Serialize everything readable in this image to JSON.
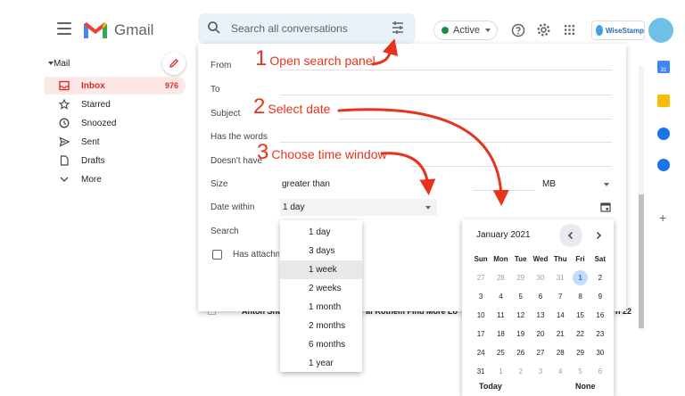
{
  "header": {
    "app_name": "Gmail",
    "search_placeholder": "Search all conversations",
    "status_label": "Active",
    "wisestamp_label": "WiseStamp"
  },
  "sidebar": {
    "section_label": "Mail",
    "items": [
      {
        "label": "Inbox",
        "count": "976",
        "icon": "inbox-icon"
      },
      {
        "label": "Starred",
        "icon": "star-icon"
      },
      {
        "label": "Snoozed",
        "icon": "clock-icon"
      },
      {
        "label": "Sent",
        "icon": "send-icon"
      },
      {
        "label": "Drafts",
        "icon": "draft-icon"
      },
      {
        "label": "More",
        "icon": "chevron-down-icon"
      }
    ]
  },
  "search_panel": {
    "from_label": "From",
    "to_label": "To",
    "subject_label": "Subject",
    "has_words_label": "Has the words",
    "doesnt_have_label": "Doesn't have",
    "size_label": "Size",
    "size_operator": "greater than",
    "size_unit": "MB",
    "date_within_label": "Date within",
    "date_within_value": "1 day",
    "search_label": "Search",
    "has_attachment_label": "Has attachment"
  },
  "date_dropdown": {
    "options": [
      "1 day",
      "3 days",
      "1 week",
      "2 weeks",
      "1 month",
      "2 months",
      "6 months",
      "1 year"
    ],
    "highlighted": "1 week"
  },
  "calendar": {
    "month_label": "January 2021",
    "weekdays": [
      "Sun",
      "Mon",
      "Tue",
      "Wed",
      "Thu",
      "Fri",
      "Sat"
    ],
    "weeks": [
      [
        "27",
        "28",
        "29",
        "30",
        "31",
        "1",
        "2"
      ],
      [
        "3",
        "4",
        "5",
        "6",
        "7",
        "8",
        "9"
      ],
      [
        "10",
        "11",
        "12",
        "13",
        "14",
        "15",
        "16"
      ],
      [
        "17",
        "18",
        "19",
        "20",
        "21",
        "22",
        "23"
      ],
      [
        "24",
        "25",
        "26",
        "27",
        "28",
        "29",
        "30"
      ],
      [
        "31",
        "1",
        "2",
        "3",
        "4",
        "5",
        "6"
      ]
    ],
    "selected_day": "1",
    "today_label": "Today",
    "none_label": "None"
  },
  "email_row": {
    "sender": "Anton Shu",
    "subject": "af Rothem Find More Lo",
    "date": "n 22"
  },
  "annotations": [
    {
      "num": "1",
      "text": "Open search panel"
    },
    {
      "num": "2",
      "text": "Select date"
    },
    {
      "num": "3",
      "text": "Choose time window"
    }
  ],
  "colors": {
    "annotation": "#e8331c",
    "inbox_active": "#d93025",
    "accent": "#1a73e8"
  }
}
